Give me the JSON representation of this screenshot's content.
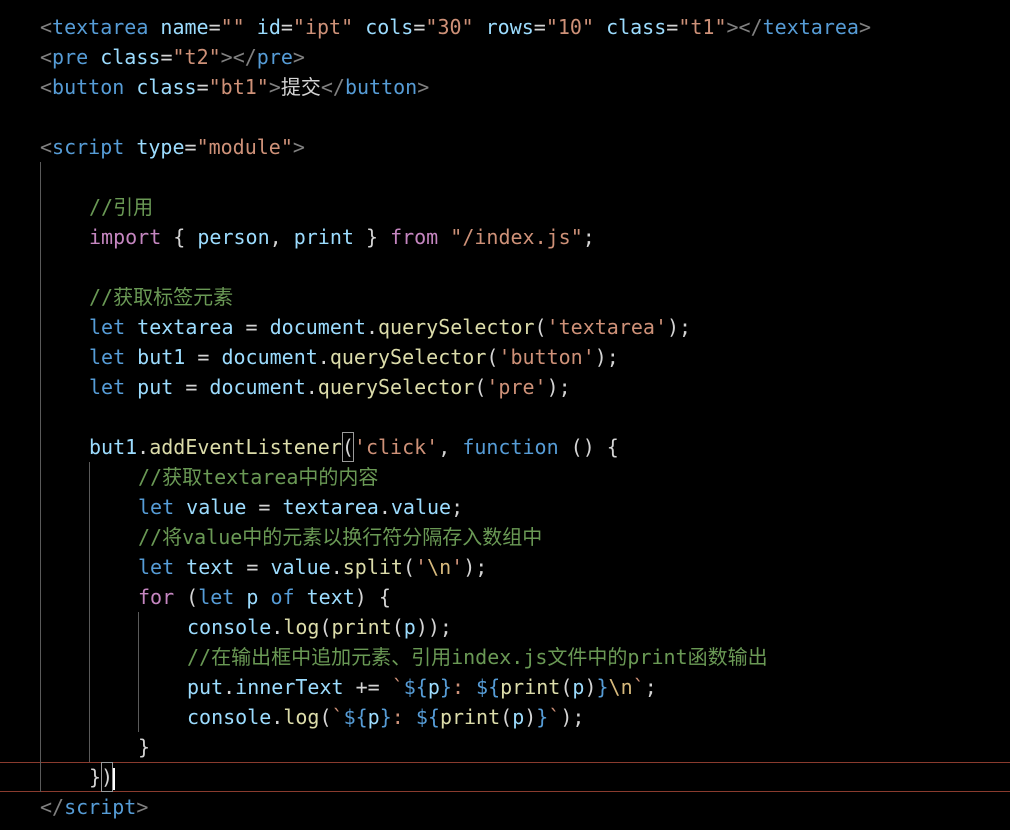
{
  "editor": {
    "lines": [
      {
        "indent": 0,
        "tokens": [
          [
            "p",
            "<"
          ],
          [
            "tag",
            "textarea"
          ],
          [
            "plain",
            " "
          ],
          [
            "attr",
            "name"
          ],
          [
            "plain",
            "="
          ],
          [
            "str",
            "\"\""
          ],
          [
            "plain",
            " "
          ],
          [
            "attr",
            "id"
          ],
          [
            "plain",
            "="
          ],
          [
            "str",
            "\"ipt\""
          ],
          [
            "plain",
            " "
          ],
          [
            "attr",
            "cols"
          ],
          [
            "plain",
            "="
          ],
          [
            "str",
            "\"30\""
          ],
          [
            "plain",
            " "
          ],
          [
            "attr",
            "rows"
          ],
          [
            "plain",
            "="
          ],
          [
            "str",
            "\"10\""
          ],
          [
            "plain",
            " "
          ],
          [
            "attr",
            "class"
          ],
          [
            "plain",
            "="
          ],
          [
            "str",
            "\"t1\""
          ],
          [
            "p",
            "></"
          ],
          [
            "tag",
            "textarea"
          ],
          [
            "p",
            ">"
          ]
        ]
      },
      {
        "indent": 0,
        "tokens": [
          [
            "p",
            "<"
          ],
          [
            "tag",
            "pre"
          ],
          [
            "plain",
            " "
          ],
          [
            "attr",
            "class"
          ],
          [
            "plain",
            "="
          ],
          [
            "str",
            "\"t2\""
          ],
          [
            "p",
            "></"
          ],
          [
            "tag",
            "pre"
          ],
          [
            "p",
            ">"
          ]
        ]
      },
      {
        "indent": 0,
        "tokens": [
          [
            "p",
            "<"
          ],
          [
            "tag",
            "button"
          ],
          [
            "plain",
            " "
          ],
          [
            "attr",
            "class"
          ],
          [
            "plain",
            "="
          ],
          [
            "str",
            "\"bt1\""
          ],
          [
            "p",
            ">"
          ],
          [
            "plain",
            "提交"
          ],
          [
            "p",
            "</"
          ],
          [
            "tag",
            "button"
          ],
          [
            "p",
            ">"
          ]
        ]
      },
      {
        "indent": 0,
        "tokens": []
      },
      {
        "indent": 0,
        "tokens": [
          [
            "p",
            "<"
          ],
          [
            "tag",
            "script"
          ],
          [
            "plain",
            " "
          ],
          [
            "attr",
            "type"
          ],
          [
            "plain",
            "="
          ],
          [
            "str",
            "\"module\""
          ],
          [
            "p",
            ">"
          ]
        ]
      },
      {
        "indent": 0,
        "tokens": []
      },
      {
        "indent": 4,
        "tokens": [
          [
            "cm",
            "//引用"
          ]
        ]
      },
      {
        "indent": 4,
        "tokens": [
          [
            "ctrl",
            "import"
          ],
          [
            "plain",
            " { "
          ],
          [
            "var",
            "person"
          ],
          [
            "plain",
            ", "
          ],
          [
            "var",
            "print"
          ],
          [
            "plain",
            " } "
          ],
          [
            "ctrl",
            "from"
          ],
          [
            "plain",
            " "
          ],
          [
            "str",
            "\"/index.js\""
          ],
          [
            "plain",
            ";"
          ]
        ]
      },
      {
        "indent": 0,
        "tokens": []
      },
      {
        "indent": 4,
        "tokens": [
          [
            "cm",
            "//获取标签元素"
          ]
        ]
      },
      {
        "indent": 4,
        "tokens": [
          [
            "kw",
            "let"
          ],
          [
            "plain",
            " "
          ],
          [
            "var",
            "textarea"
          ],
          [
            "plain",
            " = "
          ],
          [
            "var",
            "document"
          ],
          [
            "plain",
            "."
          ],
          [
            "fn",
            "querySelector"
          ],
          [
            "plain",
            "("
          ],
          [
            "str",
            "'textarea'"
          ],
          [
            "plain",
            ");"
          ]
        ]
      },
      {
        "indent": 4,
        "tokens": [
          [
            "kw",
            "let"
          ],
          [
            "plain",
            " "
          ],
          [
            "var",
            "but1"
          ],
          [
            "plain",
            " = "
          ],
          [
            "var",
            "document"
          ],
          [
            "plain",
            "."
          ],
          [
            "fn",
            "querySelector"
          ],
          [
            "plain",
            "("
          ],
          [
            "str",
            "'button'"
          ],
          [
            "plain",
            ");"
          ]
        ]
      },
      {
        "indent": 4,
        "tokens": [
          [
            "kw",
            "let"
          ],
          [
            "plain",
            " "
          ],
          [
            "var",
            "put"
          ],
          [
            "plain",
            " = "
          ],
          [
            "var",
            "document"
          ],
          [
            "plain",
            "."
          ],
          [
            "fn",
            "querySelector"
          ],
          [
            "plain",
            "("
          ],
          [
            "str",
            "'pre'"
          ],
          [
            "plain",
            ");"
          ]
        ]
      },
      {
        "indent": 0,
        "tokens": []
      },
      {
        "indent": 4,
        "tokens": [
          [
            "var",
            "but1"
          ],
          [
            "plain",
            "."
          ],
          [
            "fn",
            "addEventListener"
          ],
          [
            "box",
            "("
          ],
          [
            "str",
            "'click'"
          ],
          [
            "plain",
            ", "
          ],
          [
            "kw",
            "function"
          ],
          [
            "plain",
            " () {"
          ]
        ]
      },
      {
        "indent": 8,
        "tokens": [
          [
            "cm",
            "//获取textarea中的内容"
          ]
        ]
      },
      {
        "indent": 8,
        "tokens": [
          [
            "kw",
            "let"
          ],
          [
            "plain",
            " "
          ],
          [
            "var",
            "value"
          ],
          [
            "plain",
            " = "
          ],
          [
            "var",
            "textarea"
          ],
          [
            "plain",
            "."
          ],
          [
            "var",
            "value"
          ],
          [
            "plain",
            ";"
          ]
        ]
      },
      {
        "indent": 8,
        "tokens": [
          [
            "cm",
            "//将value中的元素以换行符分隔存入数组中"
          ]
        ]
      },
      {
        "indent": 8,
        "tokens": [
          [
            "kw",
            "let"
          ],
          [
            "plain",
            " "
          ],
          [
            "var",
            "text"
          ],
          [
            "plain",
            " = "
          ],
          [
            "var",
            "value"
          ],
          [
            "plain",
            "."
          ],
          [
            "fn",
            "split"
          ],
          [
            "plain",
            "("
          ],
          [
            "str",
            "'"
          ],
          [
            "esc",
            "\\n"
          ],
          [
            "str",
            "'"
          ],
          [
            "plain",
            ");"
          ]
        ]
      },
      {
        "indent": 8,
        "tokens": [
          [
            "ctrl",
            "for"
          ],
          [
            "plain",
            " ("
          ],
          [
            "kw",
            "let"
          ],
          [
            "plain",
            " "
          ],
          [
            "var",
            "p"
          ],
          [
            "plain",
            " "
          ],
          [
            "kw",
            "of"
          ],
          [
            "plain",
            " "
          ],
          [
            "var",
            "text"
          ],
          [
            "plain",
            ") {"
          ]
        ]
      },
      {
        "indent": 12,
        "tokens": [
          [
            "var",
            "console"
          ],
          [
            "plain",
            "."
          ],
          [
            "fn",
            "log"
          ],
          [
            "plain",
            "("
          ],
          [
            "fn",
            "print"
          ],
          [
            "plain",
            "("
          ],
          [
            "var",
            "p"
          ],
          [
            "plain",
            "));"
          ]
        ]
      },
      {
        "indent": 12,
        "tokens": [
          [
            "cm",
            "//在输出框中追加元素、引用index.js文件中的print函数输出"
          ]
        ]
      },
      {
        "indent": 12,
        "tokens": [
          [
            "var",
            "put"
          ],
          [
            "plain",
            "."
          ],
          [
            "var",
            "innerText"
          ],
          [
            "plain",
            " += "
          ],
          [
            "str",
            "`"
          ],
          [
            "tmpl",
            "${"
          ],
          [
            "var",
            "p"
          ],
          [
            "tmpl",
            "}"
          ],
          [
            "str",
            ": "
          ],
          [
            "tmpl",
            "${"
          ],
          [
            "fn",
            "print"
          ],
          [
            "plain",
            "("
          ],
          [
            "var",
            "p"
          ],
          [
            "plain",
            ")"
          ],
          [
            "tmpl",
            "}"
          ],
          [
            "esc",
            "\\n"
          ],
          [
            "str",
            "`"
          ],
          [
            "plain",
            ";"
          ]
        ]
      },
      {
        "indent": 12,
        "tokens": [
          [
            "var",
            "console"
          ],
          [
            "plain",
            "."
          ],
          [
            "fn",
            "log"
          ],
          [
            "plain",
            "("
          ],
          [
            "str",
            "`"
          ],
          [
            "tmpl",
            "${"
          ],
          [
            "var",
            "p"
          ],
          [
            "tmpl",
            "}"
          ],
          [
            "str",
            ": "
          ],
          [
            "tmpl",
            "${"
          ],
          [
            "fn",
            "print"
          ],
          [
            "plain",
            "("
          ],
          [
            "var",
            "p"
          ],
          [
            "plain",
            ")"
          ],
          [
            "tmpl",
            "}"
          ],
          [
            "str",
            "`"
          ],
          [
            "plain",
            ");"
          ]
        ]
      },
      {
        "indent": 8,
        "tokens": [
          [
            "plain",
            "}"
          ]
        ]
      },
      {
        "indent": 4,
        "tokens": [
          [
            "plain",
            "}"
          ],
          [
            "box",
            ")"
          ],
          [
            "cursor",
            ""
          ]
        ]
      },
      {
        "indent": 0,
        "tokens": [
          [
            "p",
            "</"
          ],
          [
            "tag",
            "script"
          ],
          [
            "p",
            ">"
          ]
        ]
      }
    ]
  }
}
